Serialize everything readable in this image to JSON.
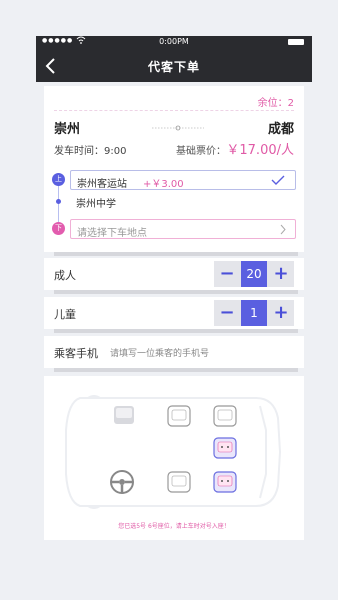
{
  "status": {
    "signal": "●●●●●",
    "wifi": "wifi",
    "time": "0:00PM"
  },
  "nav": {
    "title": "代客下单",
    "back_icon": "chevron-left-icon"
  },
  "route": {
    "seats_left": "余位：2",
    "from_city": "崇州",
    "to_city": "成都",
    "depart_time": "发车时间：9:00",
    "base_price_label": "基础票价：",
    "base_price": "￥17.00/人",
    "pickup_tag": "上",
    "dropoff_tag": "下",
    "stops": [
      {
        "name": "崇州客运站",
        "extra": "+￥3.00",
        "selected": true
      },
      {
        "name": "崇州中学"
      }
    ],
    "dropoff_placeholder": "请选择下车地点"
  },
  "adult": {
    "label": "成人",
    "minus": "−",
    "value": "20",
    "plus": "+"
  },
  "child": {
    "label": "儿童",
    "minus": "−",
    "value": "1",
    "plus": "+"
  },
  "phone": {
    "label": "乘客手机",
    "placeholder": "请填写一位乘客的手机号"
  },
  "seat_map": {
    "notice": "您已选5号 6号座位，请上车时对号入座！",
    "seats": [
      {
        "id": "front-passenger",
        "state": "driver-area"
      },
      {
        "id": "row1-mid",
        "state": "available"
      },
      {
        "id": "row1-right",
        "state": "available"
      },
      {
        "id": "row2-right",
        "state": "selected"
      },
      {
        "id": "row3-mid",
        "state": "available"
      },
      {
        "id": "row3-right",
        "state": "selected"
      }
    ]
  },
  "colors": {
    "accent": "#5a5fe0",
    "pink": "#e05aa6",
    "header": "#2a2b2f"
  }
}
